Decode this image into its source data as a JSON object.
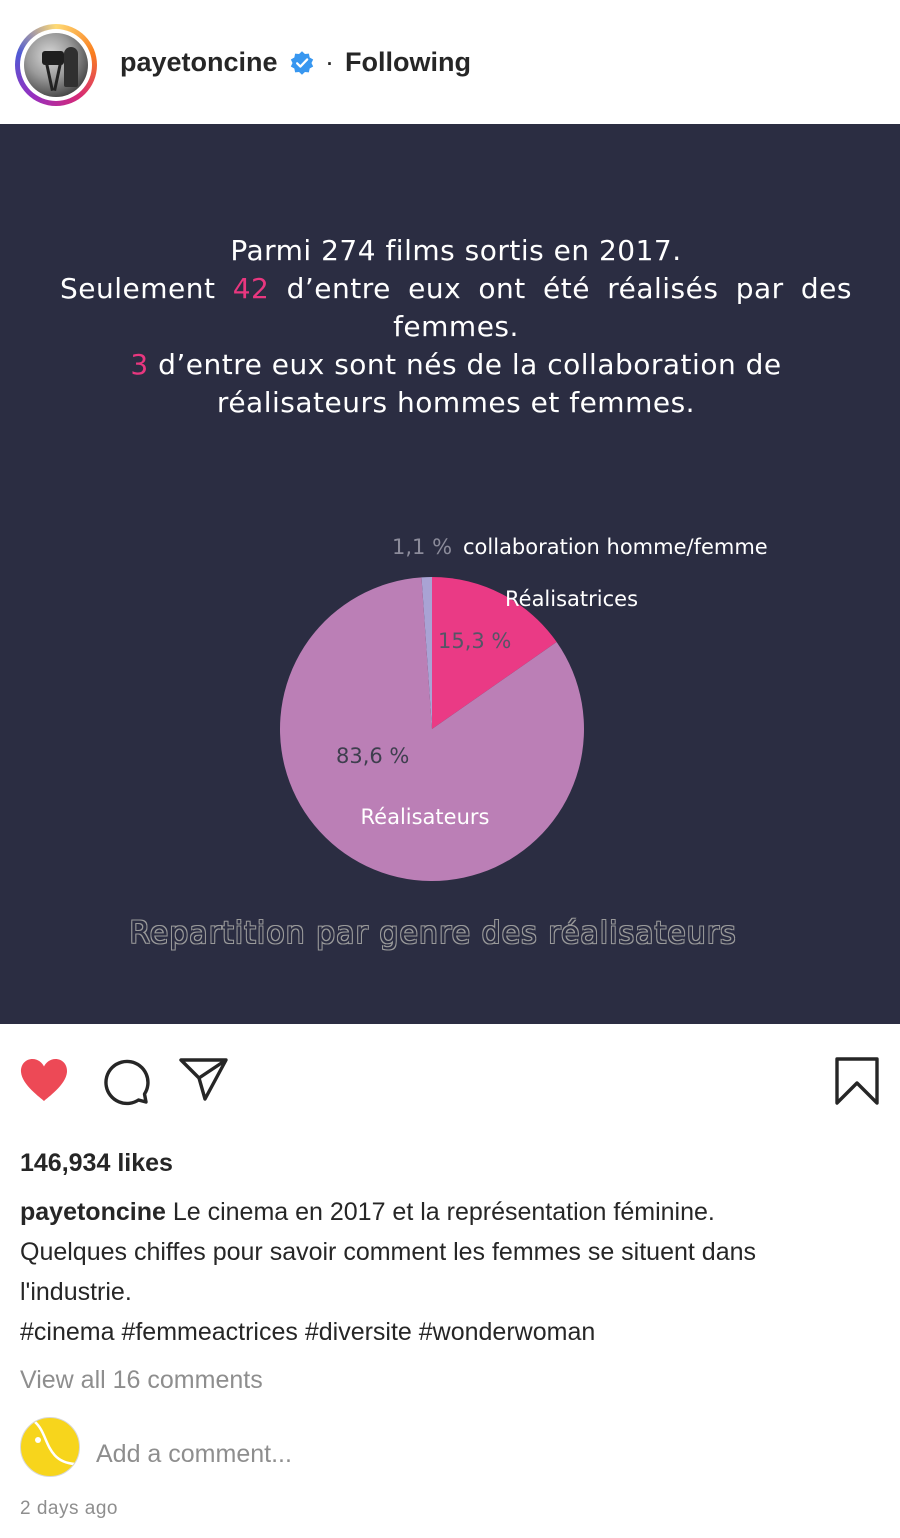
{
  "header": {
    "username": "payetoncine",
    "separator": "·",
    "follow_status": "Following"
  },
  "post": {
    "headline": {
      "line1": "Parmi 274 films sortis en 2017.",
      "line2_pre": "Seulement",
      "line2_num": "42",
      "line2_post": "d’entre eux ont été réalisés par des",
      "line3": "femmes.",
      "line4_num": "3",
      "line4_post": "d’entre eux sont nés de la collaboration de",
      "line5": "réalisateurs hommes et femmes."
    },
    "chart_title": "Repartition par genre des réalisateurs"
  },
  "chart_data": {
    "type": "pie",
    "title": "Repartition par genre des réalisateurs",
    "slices": [
      {
        "label": "collaboration homme/femme",
        "value": 1.1,
        "value_label": "1,1 %",
        "color": "#a9a3d4"
      },
      {
        "label": "Réalisatrices",
        "value": 15.3,
        "value_label": "15,3 %",
        "color": "#ea3a85"
      },
      {
        "label": "Réalisateurs",
        "value": 83.6,
        "value_label": "83,6 %",
        "color": "#bb7fb6"
      }
    ]
  },
  "actions": {
    "likes": "146,934 likes"
  },
  "caption": {
    "username": "payetoncine",
    "text_line1": "Le cinema en 2017 et la représentation féminine.",
    "text_line2": "Quelques chiffes pour savoir comment les femmes se situent dans",
    "text_line3": "l'industrie.",
    "hashtags": "#cinema #femmeactrices #diversite #wonderwoman"
  },
  "comments": {
    "view_all": "View all 16 comments",
    "placeholder": "Add a comment..."
  },
  "timestamp": "2 days ago",
  "colors": {
    "post_bg": "#2b2d42",
    "accent_pink": "#e8377f",
    "like_red": "#ed4956",
    "verified_blue": "#3897f0"
  }
}
